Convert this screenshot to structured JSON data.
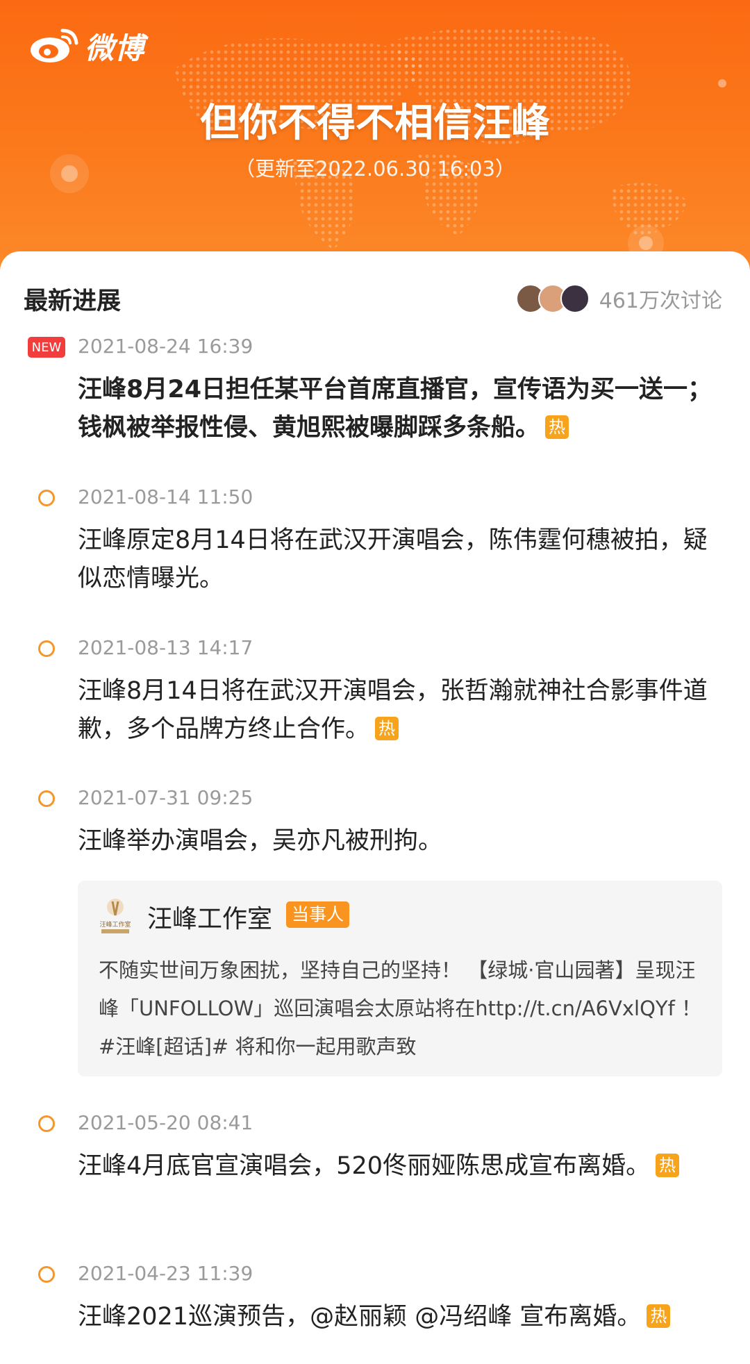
{
  "header": {
    "logo_text": "微博",
    "topic_title": "但你不得不相信汪峰",
    "updated": "（更新至2022.06.30 16:03）"
  },
  "progress": {
    "section_title": "最新进展",
    "discussions": "461万次讨论",
    "new_badge": "NEW",
    "hot_badge": "热",
    "entries": [
      {
        "time": "2021-08-24 16:39",
        "text": "汪峰8月24日担任某平台首席直播官，宣传语为买一送一；钱枫被举报性侵、黄旭熙被曝脚踩多条船。",
        "hot": true
      },
      {
        "time": "2021-08-14 11:50",
        "text": "汪峰原定8月14日将在武汉开演唱会，陈伟霆何穗被拍，疑似恋情曝光。",
        "hot": false
      },
      {
        "time": "2021-08-13 14:17",
        "text": "汪峰8月14日将在武汉开演唱会，张哲瀚就神社合影事件道歉，多个品牌方终止合作。",
        "hot": true
      },
      {
        "time": "2021-07-31 09:25",
        "text": "汪峰举办演唱会，吴亦凡被刑拘。",
        "hot": false
      },
      {
        "time": "2021-05-20 08:41",
        "text": "汪峰4月底官宣演唱会，520佟丽娅陈思成宣布离婚。",
        "hot": true
      },
      {
        "time": "2021-04-23 11:39",
        "text": "汪峰2021巡演预告，@赵丽颖 @冯绍峰 宣布离婚。",
        "hot": true
      }
    ],
    "quote": {
      "name": "汪峰工作室",
      "badge": "当事人",
      "avatar_text": "汪峰工作室",
      "body": "不随实世间万象困扰，坚持自己的坚持！ 【绿城·官山园著】呈现汪峰「UNFOLLOW」巡回演唱会太原站将在http://t.cn/A6VxlQYf ！ #汪峰[超话]# 将和你一起用歌声致"
    }
  },
  "colors": {
    "header_orange": "#fb6a12",
    "hot_badge": "#f7a41c",
    "new_badge": "#f23d3d",
    "timeline_ring": "#f5962b"
  }
}
